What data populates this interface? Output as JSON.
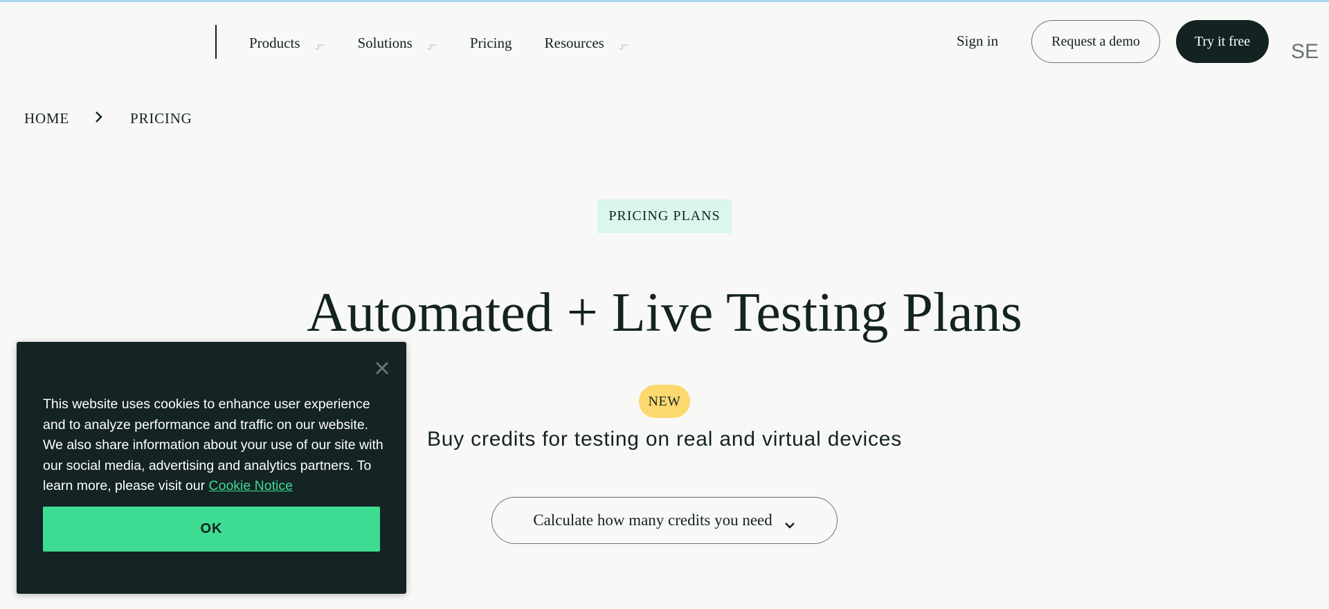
{
  "header": {
    "nav": [
      {
        "label": "Products",
        "has_dropdown": true
      },
      {
        "label": "Solutions",
        "has_dropdown": true
      },
      {
        "label": "Pricing",
        "has_dropdown": false
      },
      {
        "label": "Resources",
        "has_dropdown": true
      }
    ],
    "signin_label": "Sign in",
    "demo_label": "Request a demo",
    "try_label": "Try it free",
    "search_partial_text": "SE"
  },
  "breadcrumb": {
    "items": [
      "HOME",
      "PRICING"
    ]
  },
  "hero": {
    "tag": "PRICING PLANS",
    "title": "Automated + Live Testing Plans",
    "badge": "NEW",
    "subtitle": "Buy credits for testing on real and virtual devices",
    "calc_label": "Calculate how many credits you need"
  },
  "cookie": {
    "text": "This website uses cookies to enhance user experience and to analyze performance and traffic on our website. We also share information about your use of our site with our social media, advertising and analytics partners. To learn more, please visit our",
    "link_label": "Cookie Notice",
    "ok_label": "OK"
  },
  "colors": {
    "background": "#f8f8f7",
    "text_dark": "#132322",
    "accent_green": "#3edc92",
    "tag_bg": "#dbf6ea",
    "badge_yellow": "#fcd96f",
    "top_line": "#a9d6f0"
  },
  "icons": {
    "nav_caret": "chevron-down-icon",
    "breadcrumb_separator": "chevron-right-icon",
    "calc_caret": "chevron-down-icon",
    "cookie_close": "close-icon"
  }
}
